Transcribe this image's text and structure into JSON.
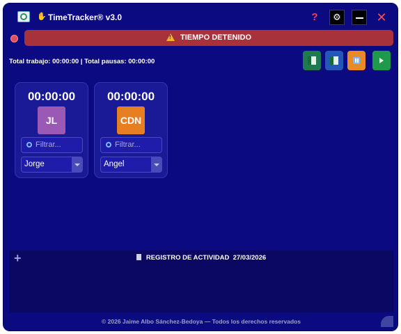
{
  "window": {
    "title": "TimeTracker® v3.0",
    "help_glyph": "?",
    "settings_glyph": "⚙",
    "close_glyph": "✕"
  },
  "status": {
    "banner": "TIEMPO DETENIDO",
    "color": "#a8323c"
  },
  "totals": {
    "text": "Total trabajo: 00:00:00 | Total pausas: 00:00:00"
  },
  "actions": [
    {
      "name": "excel-export-1",
      "icon": "excel-icon",
      "color": "#1f7a52"
    },
    {
      "name": "excel-export-2",
      "icon": "excel-icon",
      "color": "#2458b8"
    },
    {
      "name": "pause",
      "icon": "pause-icon",
      "color": "#e88a26"
    },
    {
      "name": "play",
      "icon": "play-icon",
      "color": "#1f9a4a"
    }
  ],
  "workers": [
    {
      "time": "00:00:00",
      "initials": "JL",
      "avatar_color": "#9b59b6",
      "filter_placeholder": "Filtrar...",
      "selected": "Jorge"
    },
    {
      "time": "00:00:00",
      "initials": "CDN",
      "avatar_color": "#e67e22",
      "filter_placeholder": "Filtrar...",
      "selected": "Angel"
    }
  ],
  "activity": {
    "add_glyph": "+",
    "label": "REGISTRO DE ACTIVIDAD",
    "date": "27/03/2026"
  },
  "footer": "© 2026 Jaime Albo Sánchez-Bedoya — Todos los derechos reservados"
}
